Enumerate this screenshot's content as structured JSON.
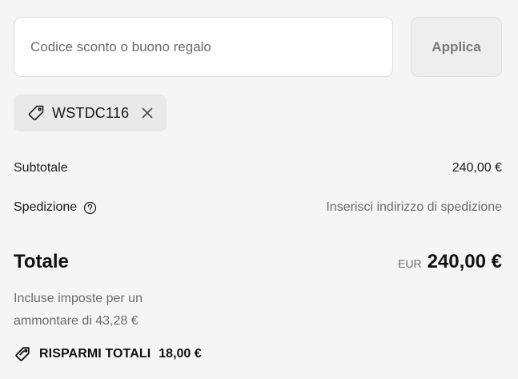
{
  "discount": {
    "input_value": "",
    "input_placeholder": "Codice sconto o buono regalo",
    "apply_label": "Applica"
  },
  "applied_code": {
    "code": "WSTDC116",
    "tag_icon": "tag-icon",
    "remove_icon": "close-icon"
  },
  "summary": {
    "subtotal_label": "Subtotale",
    "subtotal_value": "240,00 €",
    "shipping_label": "Spedizione",
    "shipping_help_icon": "question-circle-icon",
    "shipping_value": "Inserisci indirizzo di spedizione"
  },
  "total": {
    "label": "Totale",
    "currency": "EUR",
    "amount": "240,00 €",
    "tax_note": "Incluse imposte per un ammontare di 43,28 €"
  },
  "savings": {
    "icon": "tag-icon",
    "label": "RISPARMI TOTALI",
    "amount": "18,00 €"
  },
  "colors": {
    "background": "#f5f5f5",
    "input_background": "#ffffff",
    "chip_background": "#e9e9e9",
    "muted_text": "#6b6b6b",
    "primary_text": "#1a1a1a"
  }
}
